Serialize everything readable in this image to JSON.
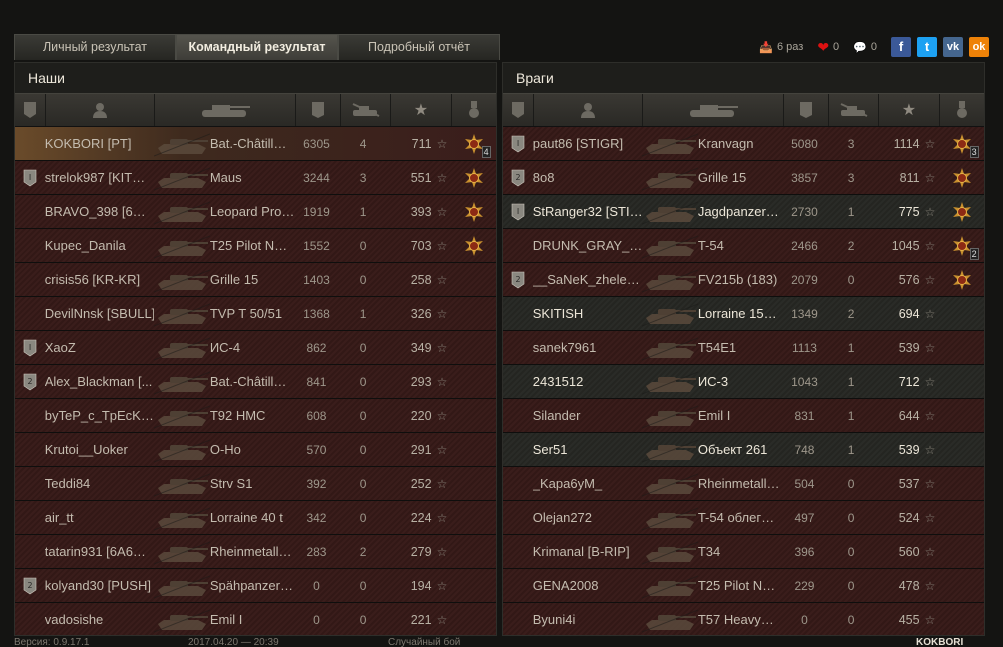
{
  "tabs": [
    "Личный результат",
    "Командный результат",
    "Подробный отчёт"
  ],
  "active_tab": 1,
  "social": {
    "replays_text": "6 раз",
    "likes_count": "0",
    "comments_count": "0",
    "buttons": [
      "f",
      "t",
      "vk",
      "ok"
    ],
    "colors": {
      "f": "#3b5998",
      "t": "#1da1f2",
      "vk": "#45668e",
      "ok": "#ee8208"
    }
  },
  "allies": {
    "title": "Наши",
    "rows": [
      {
        "name": "KOKBORI [PT]",
        "tank": "Bat.-Châtill…",
        "damage": "6305",
        "frags": "4",
        "xp": "711",
        "badge": "",
        "medal": "yes",
        "medal_count": "4",
        "state": "self"
      },
      {
        "name": "strelok987 [KIT…",
        "tank": "Maus",
        "damage": "3244",
        "frags": "3",
        "xp": "551",
        "badge": "I",
        "medal": "yes",
        "medal_count": "",
        "state": "dead"
      },
      {
        "name": "BRAVO_398 [6…",
        "tank": "Leopard Pro…",
        "damage": "1919",
        "frags": "1",
        "xp": "393",
        "badge": "",
        "medal": "yes",
        "medal_count": "",
        "state": "dead"
      },
      {
        "name": "Kupec_Danila",
        "tank": "T25 Pilot N…",
        "damage": "1552",
        "frags": "0",
        "xp": "703",
        "badge": "",
        "medal": "yes",
        "medal_count": "",
        "state": "dead"
      },
      {
        "name": "crisis56 [KR-KR]",
        "tank": "Grille 15",
        "damage": "1403",
        "frags": "0",
        "xp": "258",
        "badge": "",
        "medal": "",
        "medal_count": "",
        "state": "dead"
      },
      {
        "name": "DevilNnsk [SBULL]",
        "tank": "TVP T 50/51",
        "damage": "1368",
        "frags": "1",
        "xp": "326",
        "badge": "",
        "medal": "",
        "medal_count": "",
        "state": "dead"
      },
      {
        "name": "XaoZ",
        "tank": "ИС-4",
        "damage": "862",
        "frags": "0",
        "xp": "349",
        "badge": "I",
        "medal": "",
        "medal_count": "",
        "state": "dead"
      },
      {
        "name": "Alex_Blackman [...",
        "tank": "Bat.-Châtill…",
        "damage": "841",
        "frags": "0",
        "xp": "293",
        "badge": "2",
        "medal": "",
        "medal_count": "",
        "state": "dead"
      },
      {
        "name": "byTeP_c_TpEcK…",
        "tank": "T92 HMC",
        "damage": "608",
        "frags": "0",
        "xp": "220",
        "badge": "",
        "medal": "",
        "medal_count": "",
        "state": "dead"
      },
      {
        "name": "Krutoi__Uoker",
        "tank": "O-Ho",
        "damage": "570",
        "frags": "0",
        "xp": "291",
        "badge": "",
        "medal": "",
        "medal_count": "",
        "state": "dead"
      },
      {
        "name": "Teddi84",
        "tank": "Strv S1",
        "damage": "392",
        "frags": "0",
        "xp": "252",
        "badge": "",
        "medal": "",
        "medal_count": "",
        "state": "dead"
      },
      {
        "name": "air_tt",
        "tank": "Lorraine 40 t",
        "damage": "342",
        "frags": "0",
        "xp": "224",
        "badge": "",
        "medal": "",
        "medal_count": "",
        "state": "dead"
      },
      {
        "name": "tatarin931 [6A6…",
        "tank": "Rheinmetall…",
        "damage": "283",
        "frags": "2",
        "xp": "279",
        "badge": "",
        "medal": "",
        "medal_count": "",
        "state": "dead"
      },
      {
        "name": "kolyand30 [PUSH]",
        "tank": "Spähpanzer…",
        "damage": "0",
        "frags": "0",
        "xp": "194",
        "badge": "2",
        "medal": "",
        "medal_count": "",
        "state": "dead"
      },
      {
        "name": "vadosishe",
        "tank": "Emil I",
        "damage": "0",
        "frags": "0",
        "xp": "221",
        "badge": "",
        "medal": "",
        "medal_count": "",
        "state": "dead"
      }
    ]
  },
  "enemies": {
    "title": "Враги",
    "rows": [
      {
        "name": "paut86 [STIGR]",
        "tank": "Kranvagn",
        "damage": "5080",
        "frags": "3",
        "xp": "1114",
        "badge": "I",
        "medal": "yes",
        "medal_count": "3",
        "state": "dead"
      },
      {
        "name": "8o8",
        "tank": "Grille 15",
        "damage": "3857",
        "frags": "3",
        "xp": "811",
        "badge": "2",
        "medal": "yes",
        "medal_count": "",
        "state": "dead"
      },
      {
        "name": "StRanger32 [STI…",
        "tank": "Jagdpanzer…",
        "damage": "2730",
        "frags": "1",
        "xp": "775",
        "badge": "I",
        "medal": "yes",
        "medal_count": "",
        "state": "alive"
      },
      {
        "name": "DRUNK_GRAY_…",
        "tank": "T-54",
        "damage": "2466",
        "frags": "2",
        "xp": "1045",
        "badge": "",
        "medal": "yes",
        "medal_count": "2",
        "state": "dead"
      },
      {
        "name": "__SaNeK_zhele…",
        "tank": "FV215b (183)",
        "damage": "2079",
        "frags": "0",
        "xp": "576",
        "badge": "2",
        "medal": "yes",
        "medal_count": "",
        "state": "dead"
      },
      {
        "name": "SKITISH",
        "tank": "Lorraine 15…",
        "damage": "1349",
        "frags": "2",
        "xp": "694",
        "badge": "",
        "medal": "",
        "medal_count": "",
        "state": "alive"
      },
      {
        "name": "sanek7961",
        "tank": "T54E1",
        "damage": "1113",
        "frags": "1",
        "xp": "539",
        "badge": "",
        "medal": "",
        "medal_count": "",
        "state": "dead"
      },
      {
        "name": "2431512",
        "tank": "ИС-3",
        "damage": "1043",
        "frags": "1",
        "xp": "712",
        "badge": "",
        "medal": "",
        "medal_count": "",
        "state": "alive"
      },
      {
        "name": "Silander",
        "tank": "Emil I",
        "damage": "831",
        "frags": "1",
        "xp": "644",
        "badge": "",
        "medal": "",
        "medal_count": "",
        "state": "dead"
      },
      {
        "name": "Ser51",
        "tank": "Объект 261",
        "damage": "748",
        "frags": "1",
        "xp": "539",
        "badge": "",
        "medal": "",
        "medal_count": "",
        "state": "alive"
      },
      {
        "name": "_Kapa6yM_",
        "tank": "Rheinmetall…",
        "damage": "504",
        "frags": "0",
        "xp": "537",
        "badge": "",
        "medal": "",
        "medal_count": "",
        "state": "dead"
      },
      {
        "name": "Olejan272",
        "tank": "T-54 облег…",
        "damage": "497",
        "frags": "0",
        "xp": "524",
        "badge": "",
        "medal": "",
        "medal_count": "",
        "state": "dead"
      },
      {
        "name": "Krimanal [B-RIP]",
        "tank": "T34",
        "damage": "396",
        "frags": "0",
        "xp": "560",
        "badge": "",
        "medal": "",
        "medal_count": "",
        "state": "dead"
      },
      {
        "name": "GENA2008",
        "tank": "T25 Pilot N…",
        "damage": "229",
        "frags": "0",
        "xp": "478",
        "badge": "",
        "medal": "",
        "medal_count": "",
        "state": "dead"
      },
      {
        "name": "Byuni4i",
        "tank": "T57 Heavy…",
        "damage": "0",
        "frags": "0",
        "xp": "455",
        "badge": "",
        "medal": "",
        "medal_count": "",
        "state": "dead"
      }
    ]
  },
  "footer": {
    "version": "Версия: 0.9.17.1",
    "date": "2017.04.20 — 20:39",
    "mode": "Случайный бой",
    "player": "KOKBORI"
  }
}
